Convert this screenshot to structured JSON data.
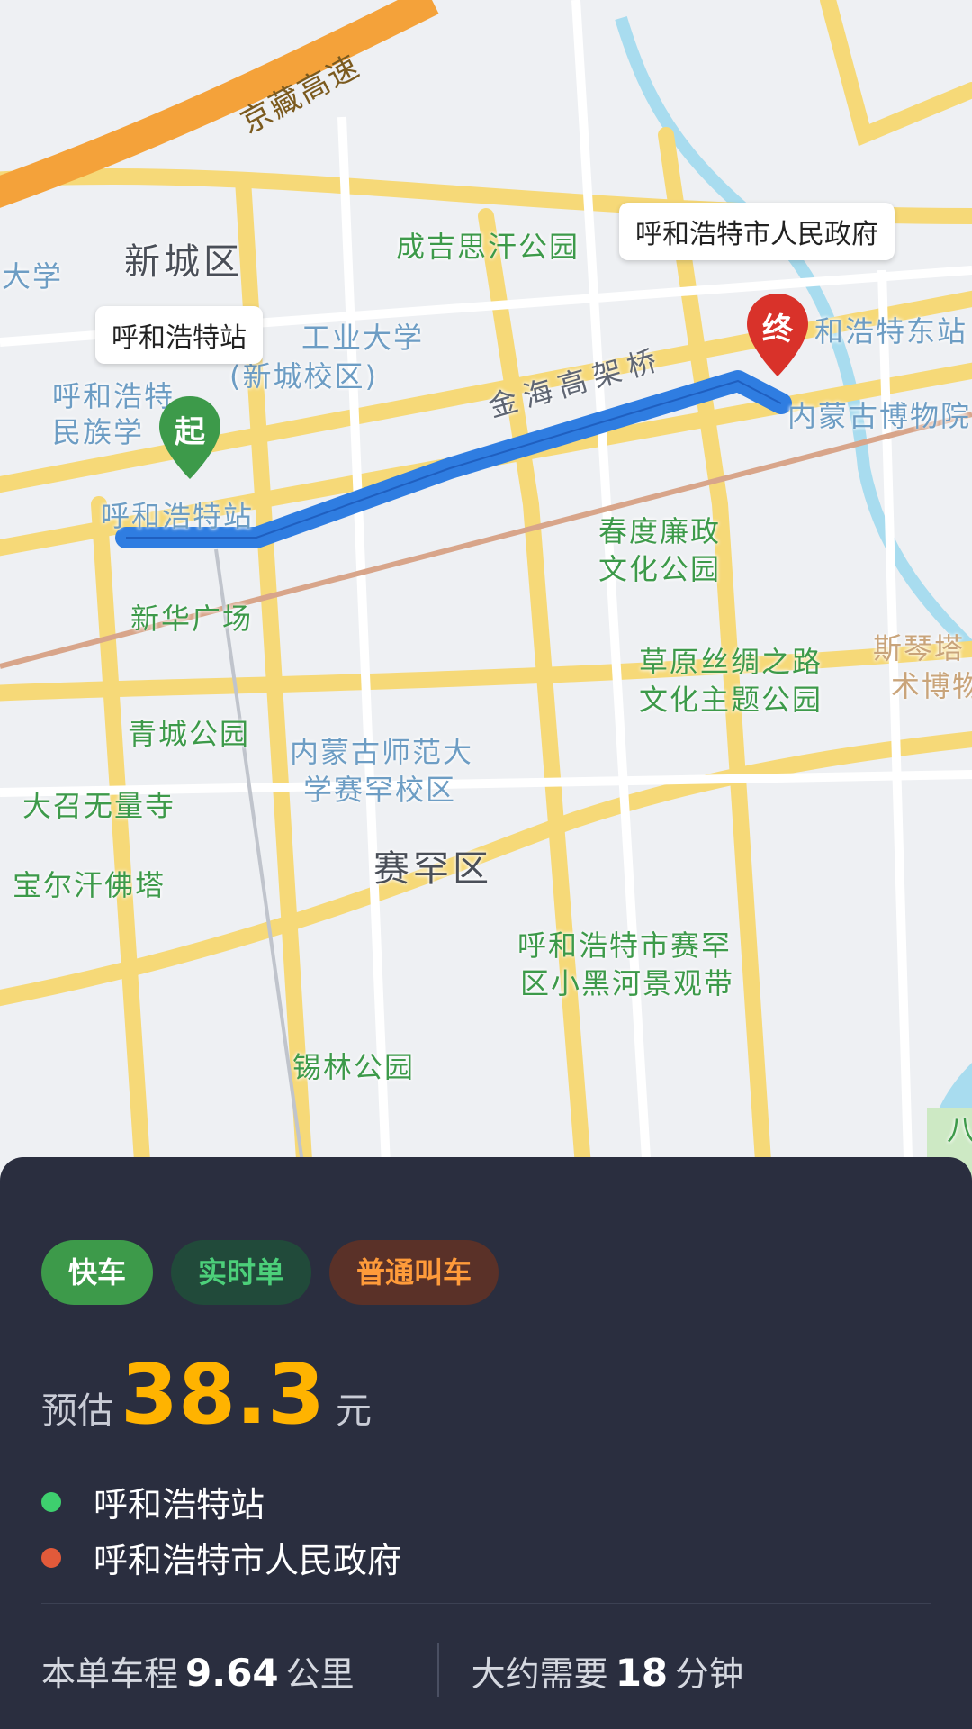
{
  "map": {
    "highway_label": "京藏高速",
    "district_labels": [
      "新城区",
      "赛罕区"
    ],
    "road_labels": [
      "金海高架桥"
    ],
    "poi_labels": [
      "大学",
      "呼和浩特",
      "民族学",
      "工业大学",
      "(新城校区)",
      "成吉思汗公园",
      "和浩特东站",
      "内蒙古博物院",
      "春度廉政",
      "文化公园",
      "草原丝绸之路",
      "文化主题公园",
      "新华广场",
      "青城公园",
      "内蒙古师范大",
      "学赛罕校区",
      "大召无量寺",
      "宝尔汗佛塔",
      "呼和浩特市赛罕",
      "区小黑河景观带",
      "锡林公园",
      "斯琴塔",
      "术博物",
      "呼和浩特站",
      "八"
    ],
    "start_callout": "呼和浩特站",
    "end_callout": "呼和浩特市人民政府",
    "start_pin_text": "起",
    "end_pin_text": "终",
    "colors": {
      "route": "#2f7de1",
      "start_pin": "#3d9a4a",
      "end_pin": "#d9322a"
    }
  },
  "panel": {
    "tags": [
      "快车",
      "实时单",
      "普通叫车"
    ],
    "price_label": "预估",
    "price_value": "38.3",
    "price_unit": "元",
    "origin": "呼和浩特站",
    "destination": "呼和浩特市人民政府",
    "distance_prefix": "本单车程",
    "distance_value": "9.64",
    "distance_unit": "公里",
    "duration_prefix": "大约需要",
    "duration_value": "18",
    "duration_unit": "分钟",
    "colors": {
      "origin_dot": "#3ecf6e",
      "destination_dot": "#e25a3a",
      "price": "#ffb300"
    }
  }
}
